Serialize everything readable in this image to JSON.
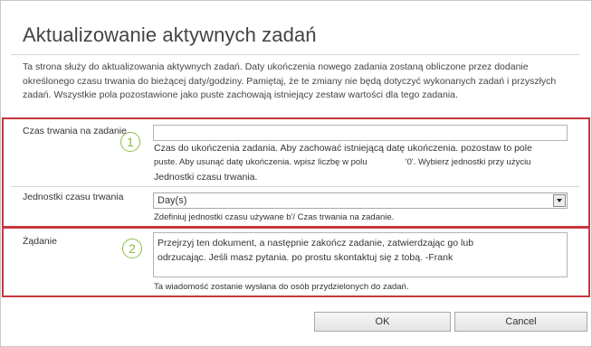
{
  "dialog": {
    "title": "Aktualizowanie aktywnych zadań",
    "intro": "Ta strona służy do aktualizowania aktywnych zadań. Daty ukończenia nowego zadania zostaną obliczone przez dodanie określonego czasu trwania do bieżącej daty/godziny. Pamiętaj, że te zmiany nie będą dotyczyć wykonanych zadań i przyszłych zadań. Wszystkie pola pozostawione jako puste zachowają istniejący zestaw wartości dla tego zadania."
  },
  "duration": {
    "label": "Czas trwania na zadanie",
    "value": "",
    "badge": "1",
    "help_line1": "Czas do ukończenia zadania. Aby zachować istniejącą datę ukończenia. pozostaw to pole",
    "help_line2": "puste. Aby usunąć datę ukończenia. wpisz liczbę w polu                '0'. Wybierz jednostki przy użyciu",
    "help_line3": "Jednostki czasu trwania."
  },
  "units": {
    "label": "Jednostki czasu trwania",
    "selected": "Day(s)",
    "help": "Zdefiniuj jednostki czasu używane b'/ Czas trwania na zadanie."
  },
  "request": {
    "label": "Żądanie",
    "badge": "2",
    "line1": "Przejrzyj ten dokument, a następnie zakończ zadanie, zatwierdzając go lub",
    "line2": "odrzucając. Jeśli masz pytania. po prostu skontaktuj się z tobą. -Frank",
    "help": "Ta wiadomość zostanie wysłana do osób przydzielonych do zadań."
  },
  "buttons": {
    "ok": "OK",
    "cancel": "Cancel"
  },
  "colors": {
    "highlight_border": "#c8373e",
    "badge": "#8dbd3f"
  }
}
